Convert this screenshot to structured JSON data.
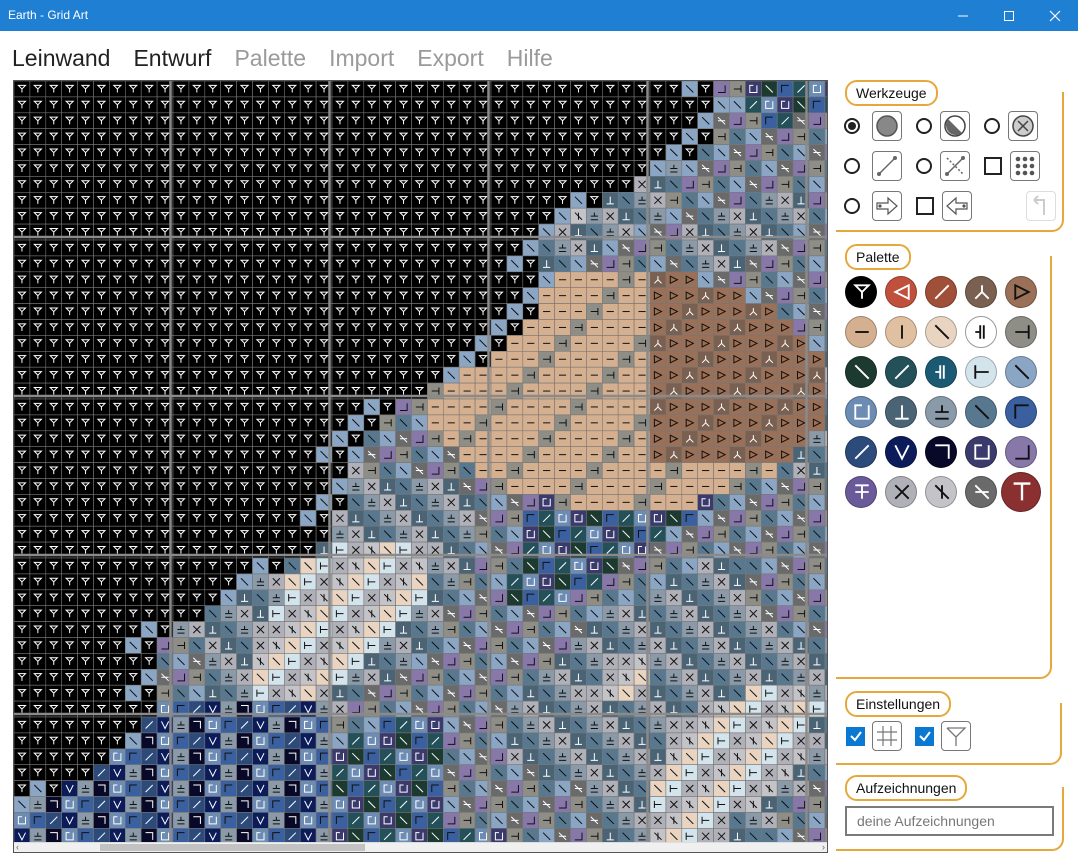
{
  "window": {
    "title": "Earth - Grid Art"
  },
  "menu": [
    "Leinwand",
    "Entwurf",
    "Palette",
    "Import",
    "Export",
    "Hilfe"
  ],
  "menu_active": [
    "Leinwand",
    "Entwurf"
  ],
  "groups": {
    "tools": "Werkzeuge",
    "palette": "Palette",
    "settings": "Einstellungen",
    "notes": "Aufzeichnungen"
  },
  "tools": [
    {
      "icon": "filled-circle-icon",
      "control": "radio",
      "selected": true
    },
    {
      "icon": "half-circle-icon",
      "control": "radio",
      "selected": false
    },
    {
      "icon": "circle-x-icon",
      "control": "radio",
      "selected": false
    },
    {
      "icon": "line-icon",
      "control": "radio",
      "selected": false
    },
    {
      "icon": "cross-line-icon",
      "control": "radio",
      "selected": false
    },
    {
      "icon": "dot-grid-icon",
      "control": "checkbox",
      "selected": false
    },
    {
      "icon": "arrow-right-icon",
      "control": "radio",
      "selected": false
    },
    {
      "icon": "arrow-left-icon",
      "control": "checkbox",
      "selected": false
    },
    {
      "icon": "undo-icon",
      "control": "none",
      "selected": false
    }
  ],
  "palette": [
    {
      "color": "#000000",
      "symbol": "funnel",
      "fg": "#ffffff"
    },
    {
      "color": "#c0503c",
      "symbol": "tri-left",
      "fg": "#ffffff"
    },
    {
      "color": "#a05038",
      "symbol": "slash",
      "fg": "#ffffff"
    },
    {
      "color": "#7a6050",
      "symbol": "tripod",
      "fg": "#ffffff"
    },
    {
      "color": "#9a7058",
      "symbol": "tri-right",
      "fg": "#111111"
    },
    {
      "color": "#d4b090",
      "symbol": "dash",
      "fg": "#111111"
    },
    {
      "color": "#e0c0a0",
      "symbol": "bar",
      "fg": "#111111"
    },
    {
      "color": "#e8d4c0",
      "symbol": "backslash",
      "fg": "#111111"
    },
    {
      "color": "#ffffff",
      "symbol": "double-bar",
      "fg": "#111111"
    },
    {
      "color": "#8e8e86",
      "symbol": "tee-right",
      "fg": "#111111"
    },
    {
      "color": "#1c3a30",
      "symbol": "backslash",
      "fg": "#ffffff"
    },
    {
      "color": "#24505a",
      "symbol": "slash",
      "fg": "#ffffff"
    },
    {
      "color": "#1c5a74",
      "symbol": "double-bar",
      "fg": "#ffffff"
    },
    {
      "color": "#d4e4ec",
      "symbol": "tee-left",
      "fg": "#111111"
    },
    {
      "color": "#8aa6c4",
      "symbol": "backslash",
      "fg": "#111111"
    },
    {
      "color": "#6c8cb4",
      "symbol": "bracket",
      "fg": "#ffffff"
    },
    {
      "color": "#4a6476",
      "symbol": "bottom-tee",
      "fg": "#ffffff"
    },
    {
      "color": "#8a9aa8",
      "symbol": "plus-minus",
      "fg": "#111111"
    },
    {
      "color": "#587890",
      "symbol": "backslash",
      "fg": "#111111"
    },
    {
      "color": "#3a60a0",
      "symbol": "corner-tl",
      "fg": "#111111"
    },
    {
      "color": "#2c4a7a",
      "symbol": "slash",
      "fg": "#ffffff"
    },
    {
      "color": "#0c1c5a",
      "symbol": "slash-v",
      "fg": "#ffffff"
    },
    {
      "color": "#080828",
      "symbol": "corner-tr",
      "fg": "#ffffff"
    },
    {
      "color": "#3a3a6c",
      "symbol": "bracket",
      "fg": "#ffffff"
    },
    {
      "color": "#8878aa",
      "symbol": "corner-br",
      "fg": "#111111"
    },
    {
      "color": "#6a5a9a",
      "symbol": "tee-top",
      "fg": "#ffffff"
    },
    {
      "color": "#b0b0b8",
      "symbol": "x",
      "fg": "#111111"
    },
    {
      "color": "#c4c4c8",
      "symbol": "x-bar",
      "fg": "#111111"
    },
    {
      "color": "#6a6a6a",
      "symbol": "slash-x",
      "fg": "#ffffff"
    },
    {
      "color": "#8a3030",
      "symbol": "big-tee",
      "fg": "#ffffff"
    }
  ],
  "settings": [
    {
      "icon": "grid-icon",
      "checked": true
    },
    {
      "icon": "funnel-icon",
      "checked": true
    }
  ],
  "notes": {
    "placeholder": "deine Aufzeichnungen"
  }
}
